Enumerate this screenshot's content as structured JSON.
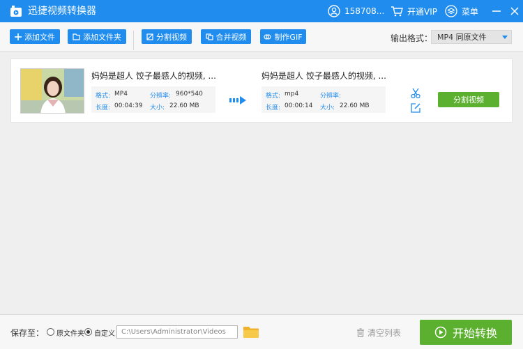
{
  "app": {
    "title": "迅捷视频转换器",
    "user_label": "158708...",
    "vip_label": "开通VIP",
    "menu_label": "菜单",
    "accent_color": "#1f8cee",
    "green_color": "#5cb030"
  },
  "toolbar": {
    "add_file": "添加文件",
    "add_folder": "添加文件夹",
    "split_video": "分割视频",
    "merge_video": "合并视频",
    "make_gif": "制作GIF",
    "output_format_label": "输出格式：",
    "output_format_value": "MP4  同原文件"
  },
  "file": {
    "source": {
      "name": "妈妈是超人 饺子最感人的视频, ...",
      "format_key": "格式:",
      "format_val": "MP4",
      "res_key": "分辨率:",
      "res_val": "960*540",
      "duration_key": "长度:",
      "duration_val": "00:04:39",
      "size_key": "大小:",
      "size_val": "22.60 MB"
    },
    "target": {
      "name": "妈妈是超人 饺子最感人的视频, ...",
      "format_key": "格式:",
      "format_val": "mp4",
      "res_key": "分辨率:",
      "res_val": "",
      "duration_key": "长度:",
      "duration_val": "00:00:14",
      "size_key": "大小:",
      "size_val": "22.60 MB"
    },
    "split_button": "分割视频"
  },
  "bottom": {
    "save_to": "保存至：",
    "option_original": "原文件夹",
    "option_custom": "自定义",
    "path": "C:\\Users\\Administrator\\Videos",
    "clear_list": "清空列表",
    "start": "开始转换"
  }
}
